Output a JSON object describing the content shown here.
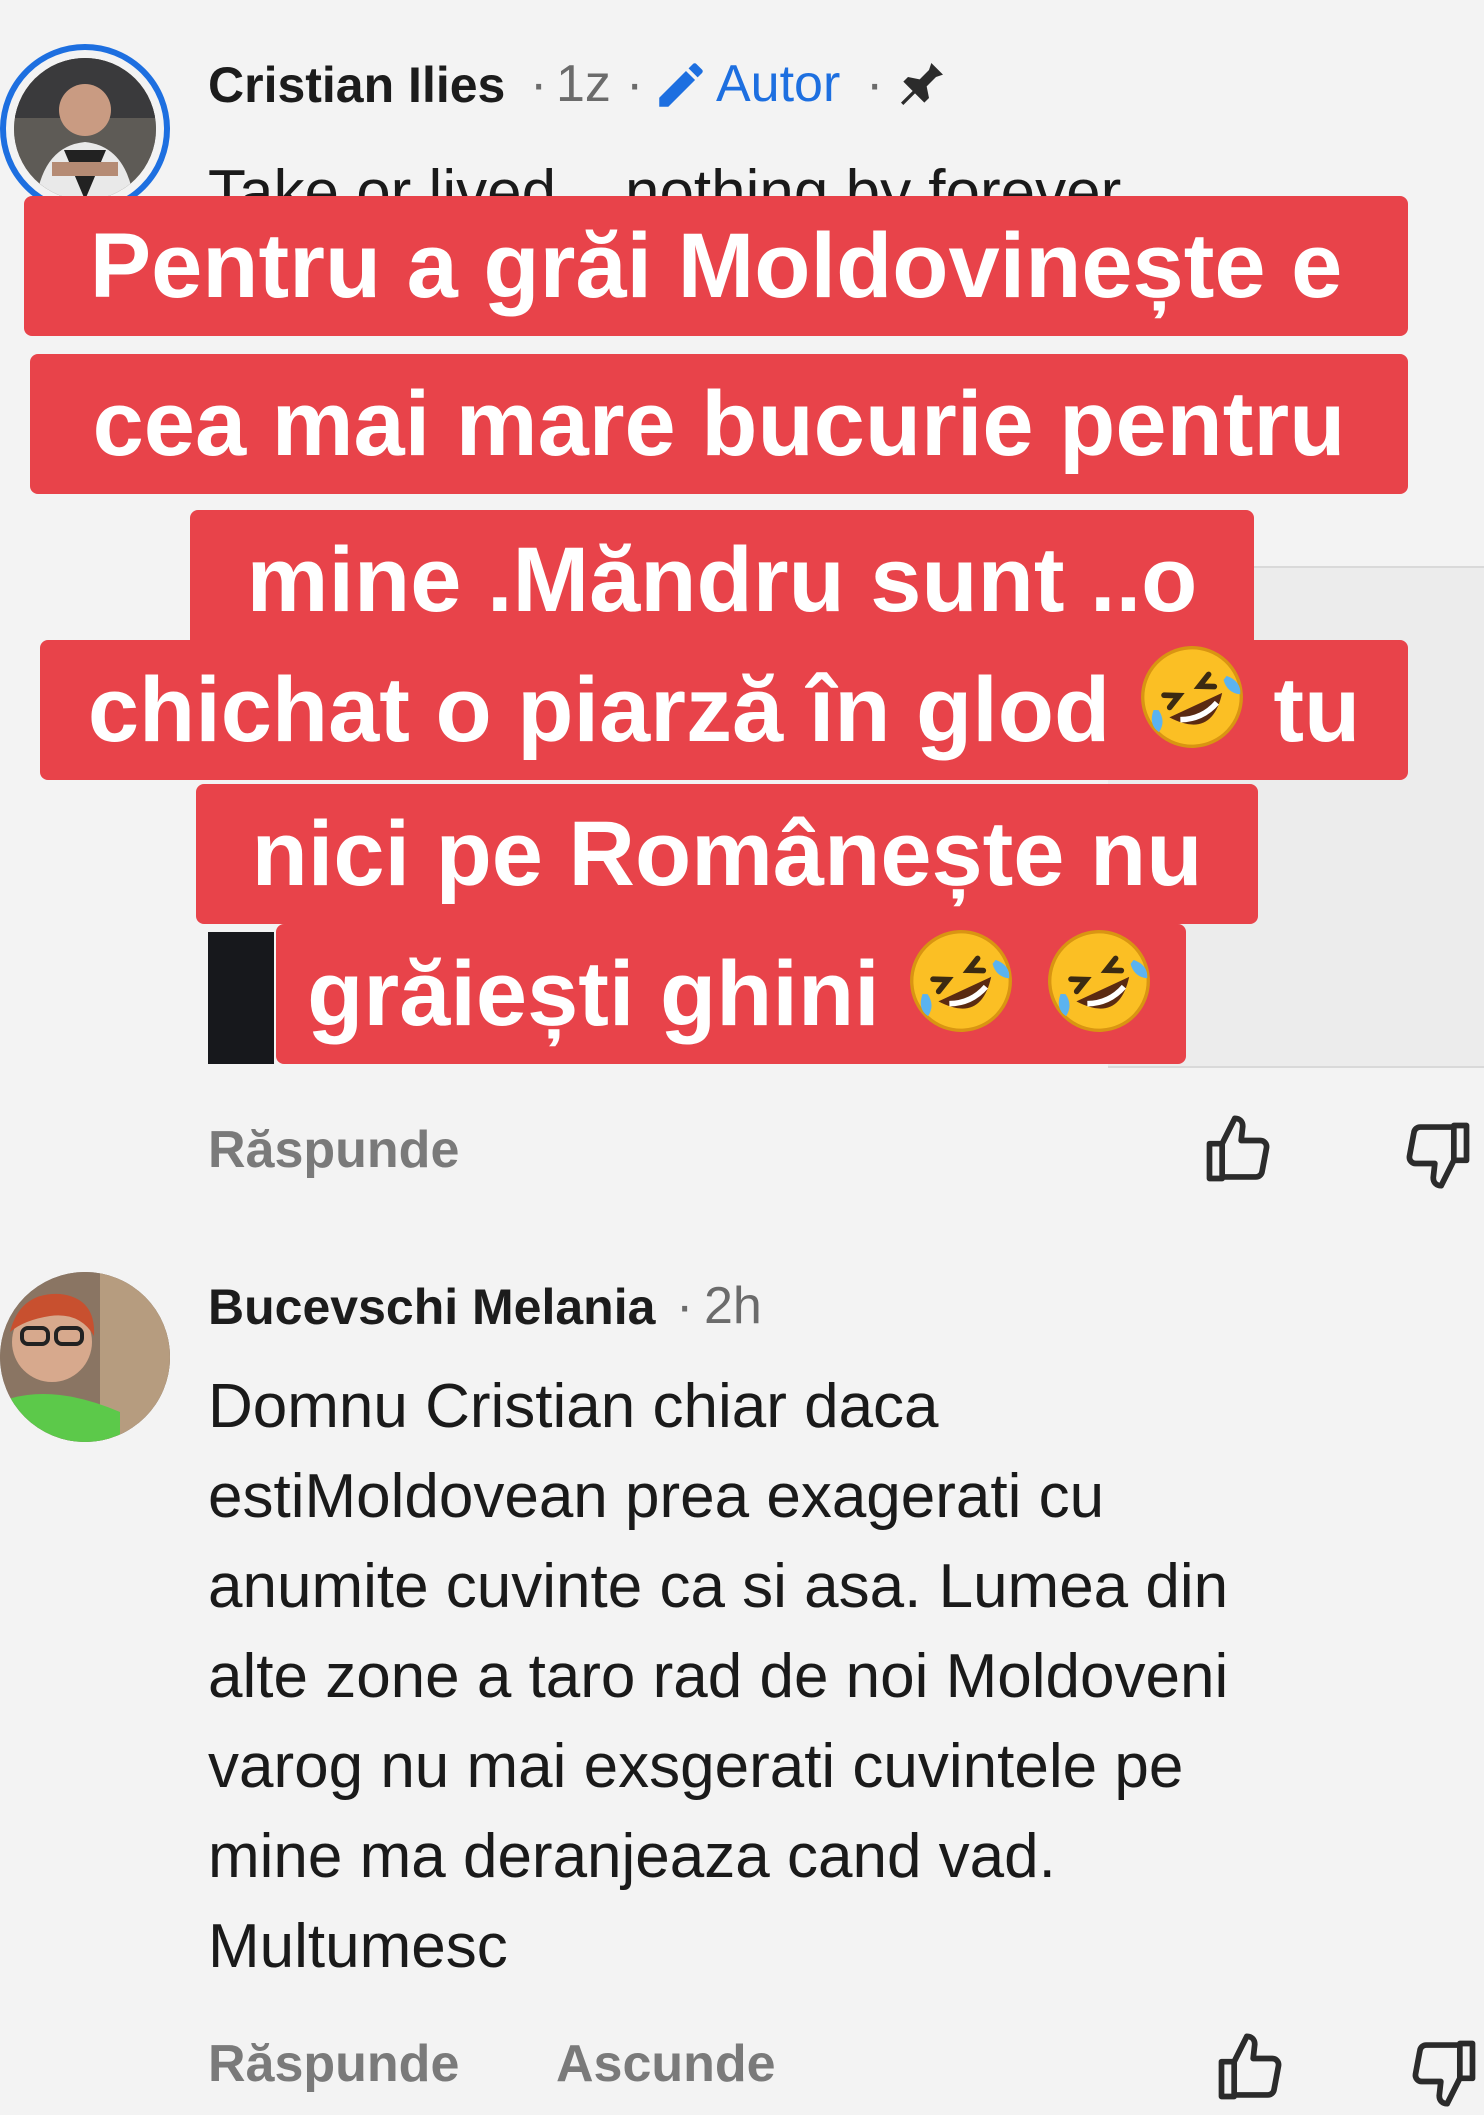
{
  "comments": [
    {
      "author": "Cristian Ilies",
      "time": "1z",
      "author_badge": "Autor",
      "pinned_icon": "pin-icon",
      "text": "Take or lived... nothing by forever",
      "reply_label": "Răspunde"
    },
    {
      "author": "Bucevschi Melania",
      "time": "2h",
      "text_lines": [
        "Domnu Cristian chiar daca",
        "estiMoldovean prea exagerati cu",
        "anumite cuvinte ca si asa. Lumea din",
        "alte zone a taro rad de noi Moldoveni",
        "varog nu mai exsgerati cuvintele pe",
        "mine ma deranjeaza cand vad.",
        "Multumesc"
      ],
      "reply_label": "Răspunde",
      "hide_label": "Ascunde"
    }
  ],
  "overlay": {
    "lines": [
      "Pentru a grăi Moldovinește e",
      "cea mai mare bucurie pentru",
      "mine .Măndru sunt ..o",
      "chichat o piarză în glod",
      "nici pe Românește nu",
      "grăiești ghini"
    ],
    "line4_suffix": "tu",
    "emoji": "rolling-on-floor-laughing",
    "background_color": "#e8434a"
  },
  "icons": [
    "edit-pencil-icon",
    "pin-icon",
    "thumbs-up-icon",
    "thumbs-down-icon"
  ],
  "colors": {
    "accent": "#1d6fe0",
    "muted": "#6b6b6b",
    "background": "#f3f3f3"
  }
}
